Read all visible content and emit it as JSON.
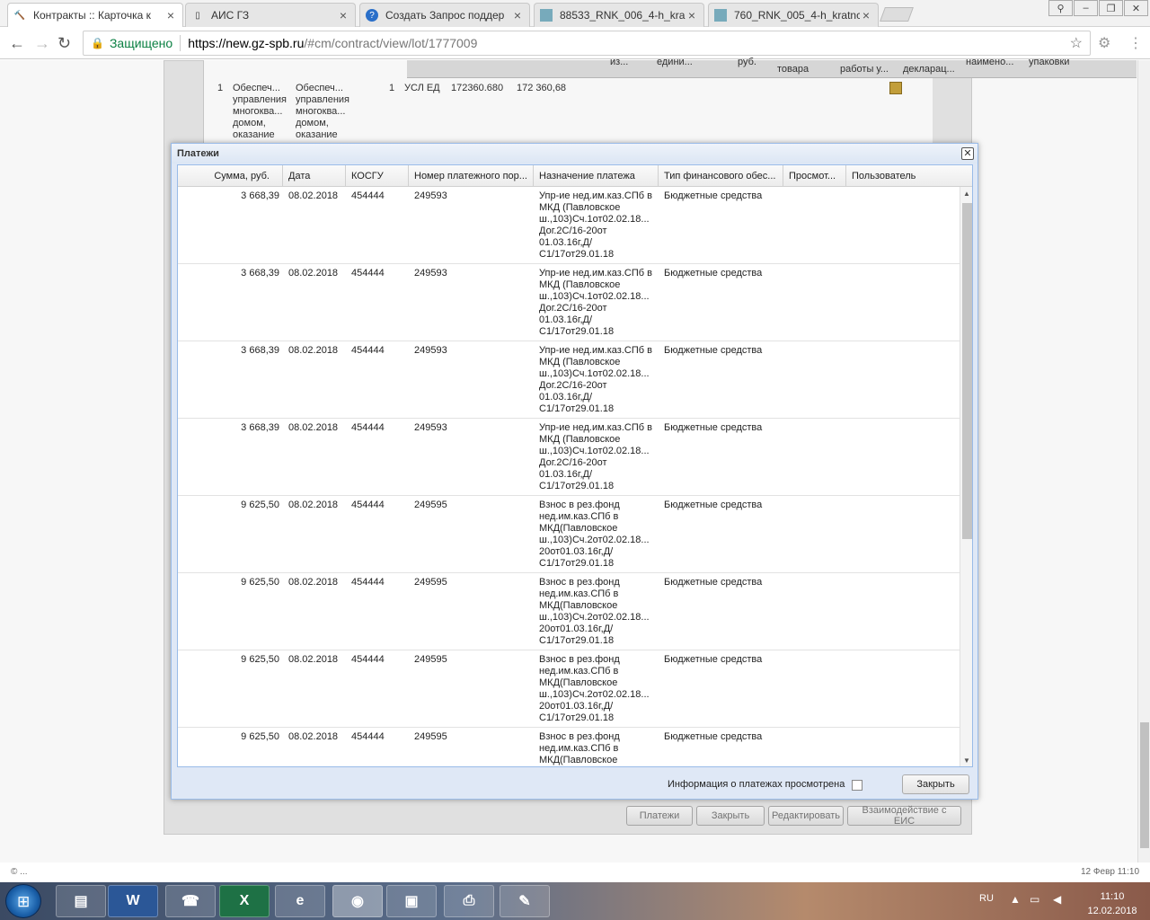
{
  "browser": {
    "tabs": [
      {
        "title": "Контракты :: Карточка к",
        "active": true,
        "icon": "hammer-icon"
      },
      {
        "title": "АИС ГЗ",
        "active": false,
        "icon": "page-icon"
      },
      {
        "title": "Создать Запрос поддер",
        "active": false,
        "icon": "help-icon"
      },
      {
        "title": "88533_RNK_006_4-h_kra",
        "active": false,
        "icon": "image-icon"
      },
      {
        "title": "760_RNK_005_4-h_kratnc",
        "active": false,
        "icon": "image-icon"
      }
    ],
    "secure_label": "Защищено",
    "url_host": "https://new.gz-spb.ru",
    "url_path": "/#cm/contract/view/lot/1777009"
  },
  "background": {
    "header_fragments": [
      "из...",
      "едини...",
      "руб.",
      "товара",
      "работы у...",
      "декларац...",
      "наимено...",
      "упаковки"
    ],
    "row": {
      "index": "1",
      "col1": "Обеспеч... управления многоква... домом, оказание",
      "col2": "Обеспеч... управления многоква... домом, оказание",
      "qty": "1",
      "unit": "УСЛ ЕД",
      "price": "172360.680",
      "total": "172 360,68"
    },
    "buttons": {
      "payments": "Платежи",
      "close": "Закрыть",
      "edit": "Редактировать",
      "eis": "Взаимодействие с ЕИС"
    }
  },
  "modal": {
    "title": "Платежи",
    "columns": [
      "Сумма, руб.",
      "Дата",
      "КОСГУ",
      "Номер платежного пор...",
      "Назначение платежа",
      "Тип финансового обес...",
      "Просмот...",
      "Пользователь"
    ],
    "rows": [
      {
        "sum": "3 668,39",
        "date": "08.02.2018",
        "kosgu": "454444",
        "num": "249593",
        "purpose": [
          "Упр-ие нед.им.каз.СПб в",
          "МКД (Павловское",
          "ш.,103)Сч.1от02.02.18...",
          "Дог.2С/16-20от",
          "01.03.16г,Д/",
          "С1/17от29.01.18"
        ],
        "fin": "Бюджетные средства"
      },
      {
        "sum": "3 668,39",
        "date": "08.02.2018",
        "kosgu": "454444",
        "num": "249593",
        "purpose": [
          "Упр-ие нед.им.каз.СПб в",
          "МКД (Павловское",
          "ш.,103)Сч.1от02.02.18...",
          "Дог.2С/16-20от",
          "01.03.16г,Д/",
          "С1/17от29.01.18"
        ],
        "fin": "Бюджетные средства"
      },
      {
        "sum": "3 668,39",
        "date": "08.02.2018",
        "kosgu": "454444",
        "num": "249593",
        "purpose": [
          "Упр-ие нед.им.каз.СПб в",
          "МКД (Павловское",
          "ш.,103)Сч.1от02.02.18...",
          "Дог.2С/16-20от",
          "01.03.16г,Д/",
          "С1/17от29.01.18"
        ],
        "fin": "Бюджетные средства"
      },
      {
        "sum": "3 668,39",
        "date": "08.02.2018",
        "kosgu": "454444",
        "num": "249593",
        "purpose": [
          "Упр-ие нед.им.каз.СПб в",
          "МКД (Павловское",
          "ш.,103)Сч.1от02.02.18...",
          "Дог.2С/16-20от",
          "01.03.16г,Д/",
          "С1/17от29.01.18"
        ],
        "fin": "Бюджетные средства"
      },
      {
        "sum": "9 625,50",
        "date": "08.02.2018",
        "kosgu": "454444",
        "num": "249595",
        "purpose": [
          "Взнос в рез.фонд",
          "нед.им.каз.СПб в",
          "МКД(Павловское",
          "ш.,103)Сч.2от02.02.18...",
          "20от01.03.16г,Д/",
          "С1/17от29.01.18"
        ],
        "fin": "Бюджетные средства"
      },
      {
        "sum": "9 625,50",
        "date": "08.02.2018",
        "kosgu": "454444",
        "num": "249595",
        "purpose": [
          "Взнос в рез.фонд",
          "нед.им.каз.СПб в",
          "МКД(Павловское",
          "ш.,103)Сч.2от02.02.18...",
          "20от01.03.16г,Д/",
          "С1/17от29.01.18"
        ],
        "fin": "Бюджетные средства"
      },
      {
        "sum": "9 625,50",
        "date": "08.02.2018",
        "kosgu": "454444",
        "num": "249595",
        "purpose": [
          "Взнос в рез.фонд",
          "нед.им.каз.СПб в",
          "МКД(Павловское",
          "ш.,103)Сч.2от02.02.18...",
          "20от01.03.16г,Д/",
          "С1/17от29.01.18"
        ],
        "fin": "Бюджетные средства"
      },
      {
        "sum": "9 625,50",
        "date": "08.02.2018",
        "kosgu": "454444",
        "num": "249595",
        "purpose": [
          "Взнос в рез.фонд",
          "нед.им.каз.СПб в",
          "МКД(Павловское"
        ],
        "fin": "Бюджетные средства"
      }
    ],
    "viewed_label": "Информация о платежах просмотрена",
    "viewed_checked": false,
    "close_label": "Закрыть"
  },
  "status": {
    "left": "© ...",
    "right": "12 Февр 11:10"
  },
  "taskbar": {
    "apps": [
      "explorer-icon",
      "word-icon",
      "phone-icon",
      "excel-icon",
      "ie-icon",
      "chrome-icon",
      "photo-icon",
      "scanner-icon",
      "paint-icon"
    ],
    "lang": "RU",
    "time": "11:10",
    "date": "12.02.2018"
  }
}
